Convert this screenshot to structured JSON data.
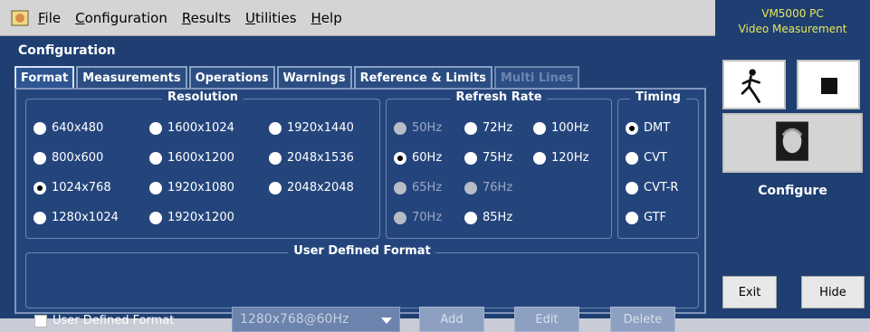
{
  "menu": {
    "items": [
      {
        "underline": "F",
        "rest": "ile"
      },
      {
        "underline": "C",
        "rest": "onfiguration"
      },
      {
        "underline": "R",
        "rest": "esults"
      },
      {
        "underline": "U",
        "rest": "tilities"
      },
      {
        "underline": "H",
        "rest": "elp"
      }
    ]
  },
  "section_title": "Configuration",
  "tabs": [
    {
      "label": "Format",
      "state": "active"
    },
    {
      "label": "Measurements",
      "state": "normal"
    },
    {
      "label": "Operations",
      "state": "normal"
    },
    {
      "label": "Warnings",
      "state": "normal"
    },
    {
      "label": "Reference & Limits",
      "state": "normal"
    },
    {
      "label": "Multi Lines",
      "state": "disabled"
    }
  ],
  "resolution": {
    "label": "Resolution",
    "options": [
      "640x480",
      "1600x1024",
      "1920x1440",
      "800x600",
      "1600x1200",
      "2048x1536",
      "1024x768",
      "1920x1080",
      "2048x2048",
      "1280x1024",
      "1920x1200"
    ],
    "selected": "1024x768"
  },
  "refresh_rate": {
    "label": "Refresh Rate",
    "options": [
      "50Hz",
      "72Hz",
      "100Hz",
      "60Hz",
      "75Hz",
      "120Hz",
      "65Hz",
      "76Hz",
      "70Hz",
      "85Hz"
    ],
    "selected": "60Hz"
  },
  "timing": {
    "label": "Timing",
    "options": [
      "DMT",
      "CVT",
      "CVT-R",
      "GTF"
    ],
    "selected": "DMT"
  },
  "user_defined": {
    "group_label": "User Defined Format",
    "checkbox_label": "User Defined Format",
    "dropdown_value": "1280x768@60Hz",
    "add_label": "Add",
    "edit_label": "Edit",
    "delete_label": "Delete"
  },
  "right_panel": {
    "title_line1": "VM5000 PC",
    "title_line2": "Video Measurement",
    "configure_label": "Configure",
    "exit_label": "Exit",
    "hide_label": "Hide"
  }
}
